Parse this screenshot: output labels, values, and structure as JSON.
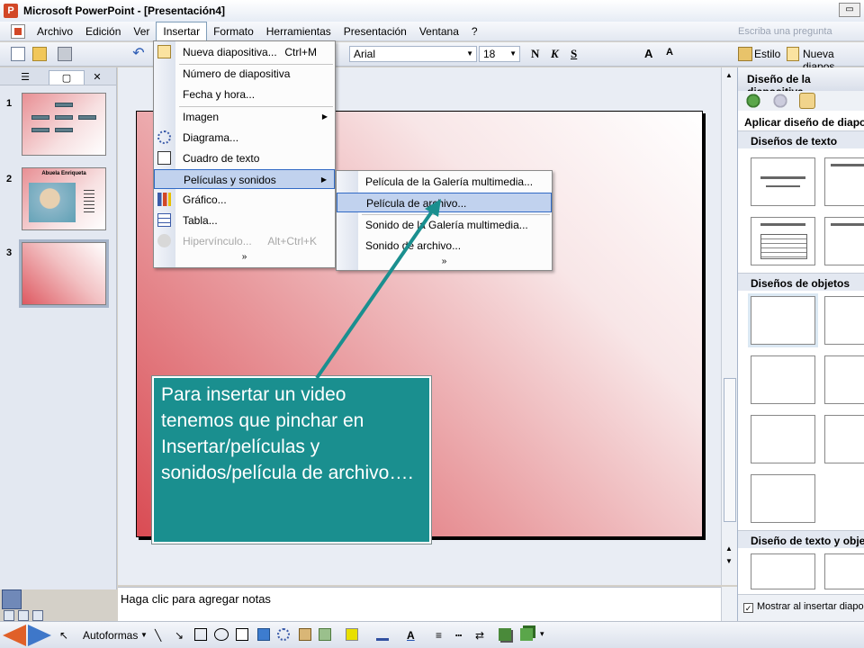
{
  "window": {
    "title": "Microsoft PowerPoint - [Presentación4]"
  },
  "menubar": {
    "items": [
      "Archivo",
      "Edición",
      "Ver",
      "Insertar",
      "Formato",
      "Herramientas",
      "Presentación",
      "Ventana",
      "?"
    ],
    "ask_placeholder": "Escriba una pregunta"
  },
  "toolbar": {
    "font": "Arial",
    "size": "18",
    "bold": "N",
    "italic": "K",
    "underline": "S",
    "style_label": "Estilo",
    "new_slide_label": "Nueva diapos"
  },
  "slides_panel": {
    "numbers": [
      "1",
      "2",
      "3"
    ],
    "slide2_title": "Abuela Enriqueta"
  },
  "insert_menu": {
    "items": [
      {
        "label": "Nueva diapositiva...",
        "shortcut": "Ctrl+M"
      },
      {
        "label": "Número de diapositiva"
      },
      {
        "label": "Fecha y hora..."
      },
      {
        "label": "Imagen"
      },
      {
        "label": "Diagrama..."
      },
      {
        "label": "Cuadro de texto"
      },
      {
        "label": "Películas y sonidos"
      },
      {
        "label": "Gráfico..."
      },
      {
        "label": "Tabla..."
      },
      {
        "label": "Hipervínculo...",
        "shortcut": "Alt+Ctrl+K"
      }
    ],
    "more": "»"
  },
  "submenu": {
    "items": [
      {
        "label": "Película de la Galería multimedia..."
      },
      {
        "label": "Película de archivo..."
      },
      {
        "label": "Sonido de la Galería multimedia..."
      },
      {
        "label": "Sonido de archivo..."
      }
    ],
    "more": "»"
  },
  "slide": {
    "callout": "Para insertar un video tenemos que pinchar en Insertar/películas y sonidos/película de archivo…."
  },
  "notes": {
    "placeholder": "Haga clic para agregar notas"
  },
  "task_pane": {
    "title": "Diseño de la diapositiva",
    "apply_label": "Aplicar diseño de diapos",
    "sections": [
      "Diseños de texto",
      "Diseños de objetos",
      "Diseño de texto y obje"
    ],
    "footer": "Mostrar al insertar diapo"
  },
  "drawing_toolbar": {
    "autoshapes": "Autoformas"
  },
  "colors": {
    "accent_teal": "#1a8f8f",
    "menu_highlight": "#c1d2ee",
    "slide_red": "#d94b53"
  }
}
